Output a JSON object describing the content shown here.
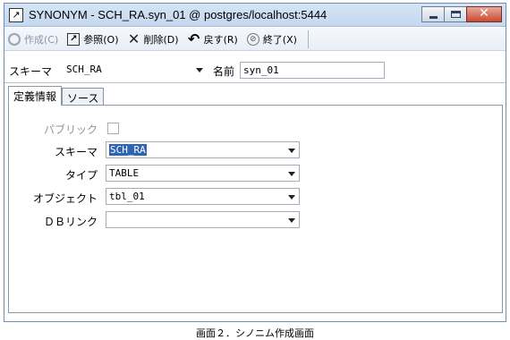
{
  "window": {
    "title": "SYNONYM - SCH_RA.syn_01 @ postgres/localhost:5444",
    "icon": "synonym-window-icon",
    "controls": [
      "minimize",
      "maximize",
      "close"
    ]
  },
  "toolbar": {
    "create_label": "作成(C)",
    "reference_label": "参照(O)",
    "delete_label": "削除(D)",
    "revert_label": "戻す(R)",
    "exit_label": "終了(X)"
  },
  "header": {
    "schema_label": "スキーマ",
    "schema_value": "SCH_RA",
    "name_label": "名前",
    "name_value": "syn_01"
  },
  "tabs": [
    {
      "label": "定義情報",
      "active": true
    },
    {
      "label": "ソース",
      "active": false
    }
  ],
  "form": {
    "public_label": "パブリック",
    "public_checked": false,
    "schema_label": "スキーマ",
    "schema_value": "SCH_RA",
    "type_label": "タイプ",
    "type_value": "TABLE",
    "object_label": "オブジェクト",
    "object_value": "tbl_01",
    "dblink_label": "ＤＢリンク",
    "dblink_value": ""
  },
  "caption": "画面２．シノニム作成画面"
}
